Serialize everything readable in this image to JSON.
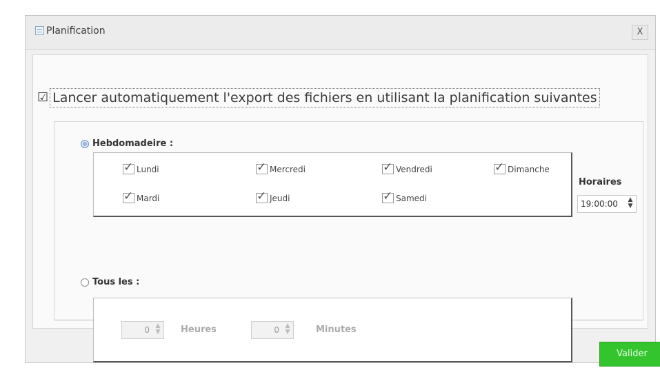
{
  "window": {
    "title": "Planification",
    "close_label": "X"
  },
  "main_checkbox": {
    "checked": true,
    "label": "Lancer automatiquement l'export des fichiers en utilisant la planification suivantes"
  },
  "weekly": {
    "label": "Hebdomadeire :",
    "selected": true,
    "days": [
      {
        "label": "Lundi",
        "checked": true
      },
      {
        "label": "Mercredi",
        "checked": true
      },
      {
        "label": "Vendredi",
        "checked": true
      },
      {
        "label": "Dimanche",
        "checked": true
      },
      {
        "label": "Mardi",
        "checked": true
      },
      {
        "label": "Jeudi",
        "checked": true
      },
      {
        "label": "Samedi",
        "checked": true
      }
    ]
  },
  "horaires": {
    "label": "Horaires",
    "value": "19:00:00"
  },
  "every": {
    "label": "Tous les :",
    "selected": false,
    "hours_value": "0",
    "hours_label": "Heures",
    "minutes_value": "0",
    "minutes_label": "Minutes"
  },
  "actions": {
    "validate_label": "Valider"
  }
}
